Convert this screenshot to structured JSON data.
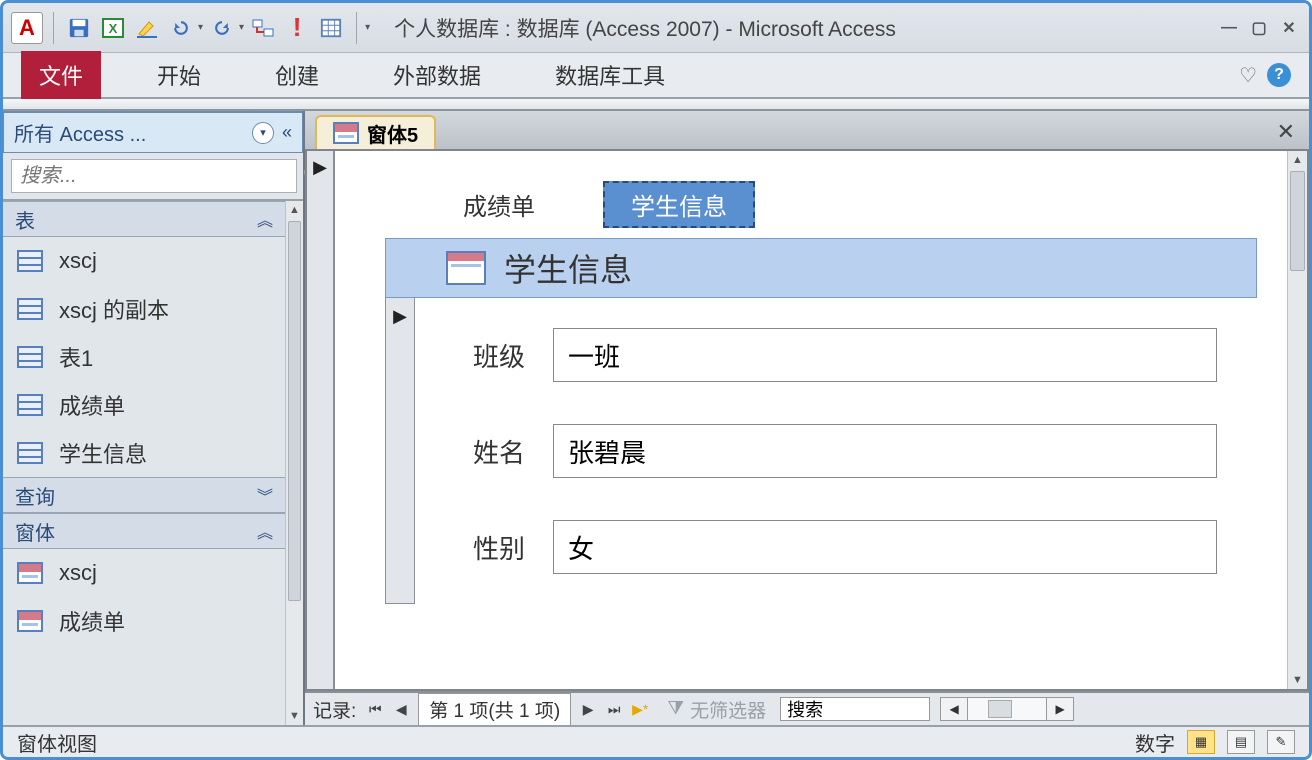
{
  "title": "个人数据库 : 数据库 (Access 2007) - Microsoft Access",
  "ribbon": {
    "file": "文件",
    "home": "开始",
    "create": "创建",
    "external": "外部数据",
    "dbtools": "数据库工具"
  },
  "navpane": {
    "header": "所有 Access ...",
    "search_placeholder": "搜索...",
    "groups": {
      "tables": "表",
      "queries": "查询",
      "forms": "窗体"
    },
    "tables": [
      "xscj",
      "xscj 的副本",
      "表1",
      "成绩单",
      "学生信息"
    ],
    "forms": [
      "xscj",
      "成绩单"
    ]
  },
  "doc": {
    "tab": "窗体5",
    "tabs": {
      "tab1": "成绩单",
      "tab2": "学生信息"
    },
    "subform_title": "学生信息",
    "fields": {
      "class_label": "班级",
      "class_value": "一班",
      "name_label": "姓名",
      "name_value": "张碧晨",
      "gender_label": "性别",
      "gender_value": "女"
    }
  },
  "recnav": {
    "label": "记录:",
    "position": "第 1 项(共 1 项)",
    "nofilter": "无筛选器",
    "search": "搜索"
  },
  "statusbar": {
    "view": "窗体视图",
    "numlock": "数字"
  }
}
